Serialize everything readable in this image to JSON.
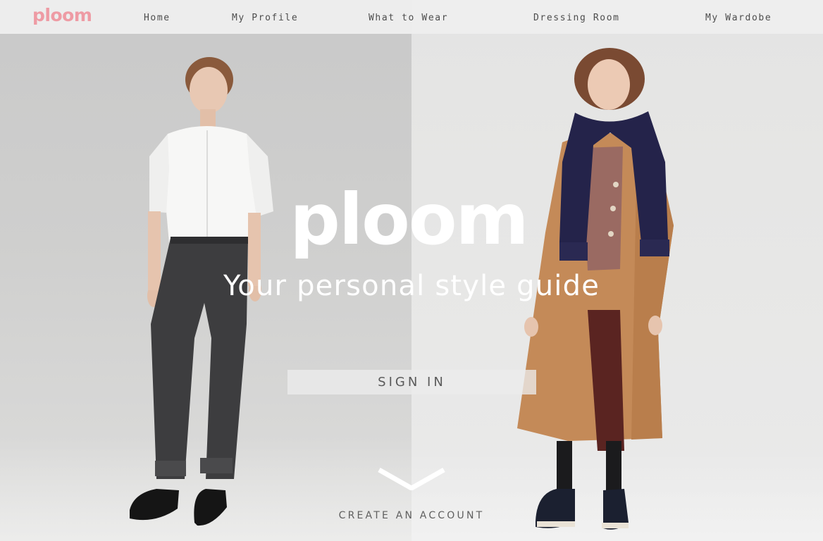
{
  "brand": {
    "logo_text": "ploom",
    "logo_color": "#ee9ba4"
  },
  "nav": {
    "items": [
      {
        "label": "Home"
      },
      {
        "label": "My Profile"
      },
      {
        "label": "What to Wear"
      },
      {
        "label": "Dressing Room"
      },
      {
        "label": "My Wardobe"
      }
    ]
  },
  "hero": {
    "title": "ploom",
    "subtitle": "Your personal style guide",
    "sign_in_label": "SIGN IN",
    "scroll_icon": "chevron-down-icon",
    "create_account_label": "CREATE AN ACCOUNT",
    "left_image": "model-white-shirt-jeans",
    "right_image": "model-camel-coat-scarf"
  }
}
